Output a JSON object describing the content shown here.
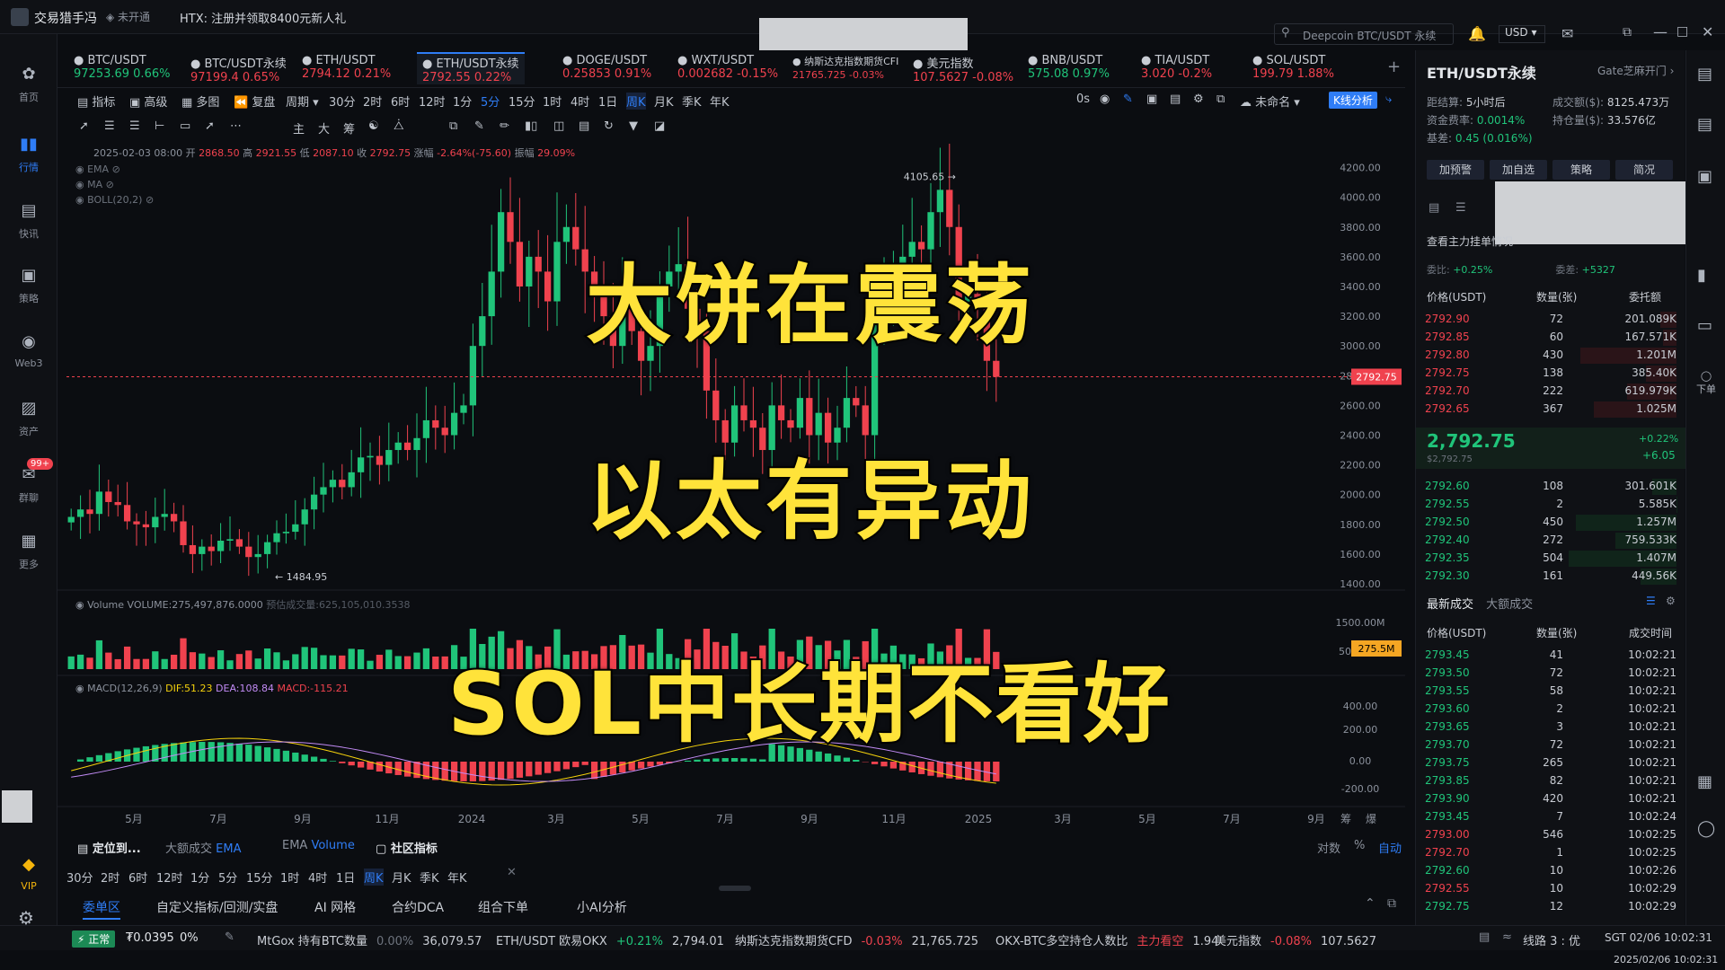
{
  "app": {
    "name": "交易猎手冯",
    "status": "未开通",
    "promo": "HTX:  注册并领取8400元新人礼",
    "search_placeholder": "Deepcoin BTC/USDT 永续",
    "currency": "USD"
  },
  "nav": [
    {
      "label": "首页",
      "icon": "home-icon"
    },
    {
      "label": "行情",
      "icon": "chart-icon"
    },
    {
      "label": "快讯",
      "icon": "news-icon"
    },
    {
      "label": "策略",
      "icon": "robot-icon"
    },
    {
      "label": "Web3",
      "icon": "web3-icon"
    },
    {
      "label": "资产",
      "icon": "wallet-icon"
    },
    {
      "label": "群聊",
      "icon": "chat-icon",
      "badge": "99+"
    },
    {
      "label": "更多",
      "icon": "grid-icon"
    },
    {
      "label": "VIP",
      "icon": "vip-icon"
    }
  ],
  "tickers": [
    {
      "name": "BTC/USDT",
      "price": "97253.69",
      "change": "0.66%",
      "dir": "green"
    },
    {
      "name": "BTC/USDT永续",
      "price": "97199.4",
      "change": "0.65%",
      "dir": "red"
    },
    {
      "name": "ETH/USDT",
      "price": "2794.12",
      "change": "0.21%",
      "dir": "red"
    },
    {
      "name": "ETH/USDT永续",
      "price": "2792.55",
      "change": "0.22%",
      "dir": "red",
      "active": true
    },
    {
      "name": "DOGE/USDT",
      "price": "0.25853",
      "change": "0.91%",
      "dir": "red"
    },
    {
      "name": "WXT/USDT",
      "price": "0.002682",
      "change": "-0.15%",
      "dir": "red"
    },
    {
      "name": "纳斯达克指数期货CFI",
      "price": "21765.725",
      "change": "-0.03%",
      "dir": "red"
    },
    {
      "name": "美元指数",
      "price": "107.5627",
      "change": "-0.08%",
      "dir": "red"
    },
    {
      "name": "BNB/USDT",
      "price": "575.08",
      "change": "0.97%",
      "dir": "green"
    },
    {
      "name": "TIA/USDT",
      "price": "3.020",
      "change": "-0.2%",
      "dir": "red"
    },
    {
      "name": "SOL/USDT",
      "price": "199.79",
      "change": "1.88%",
      "dir": "red"
    }
  ],
  "toolbar": {
    "left": [
      "指标",
      "高级",
      "多图",
      "复盘",
      "周期"
    ],
    "periods": [
      "30分",
      "2时",
      "6时",
      "12时",
      "1分",
      "5分",
      "15分",
      "1时",
      "4时",
      "1日",
      "周K",
      "月K",
      "季K",
      "年K"
    ],
    "active_period": "周K",
    "right": [
      "0s",
      "未命名",
      "K线分析"
    ],
    "draw_tools": [
      "主",
      "大",
      "筹"
    ]
  },
  "ohlc": {
    "date": "2025-02-03 08:00",
    "open_label": "开",
    "open": "2868.50",
    "high_label": "高",
    "high": "2921.55",
    "low_label": "低",
    "low": "2087.10",
    "close_label": "收",
    "close": "2792.75",
    "chg_label": "涨幅",
    "chg": "-2.64%(-75.60)",
    "amp_label": "振幅",
    "amp": "29.09%"
  },
  "indicators": [
    "EMA",
    "MA",
    "BOLL(20,2)"
  ],
  "chart_data": {
    "type": "candlestick",
    "price_axis": [
      "4200.00",
      "4000.00",
      "3800.00",
      "3600.00",
      "3400.00",
      "3200.00",
      "3000.00",
      "2800.00",
      "2600.00",
      "2400.00",
      "2200.00",
      "2000.00",
      "1800.00",
      "1600.00",
      "1400.00"
    ],
    "ylim": [
      1400,
      4300
    ],
    "last_price": "2792.75",
    "high_marker": "4105.65 →",
    "low_marker": "← 1484.95",
    "x_ticks": [
      "5月",
      "7月",
      "9月",
      "11月",
      "2024",
      "3月",
      "5月",
      "7月",
      "9月",
      "11月",
      "2025",
      "3月",
      "5月",
      "7月",
      "9月"
    ],
    "closes": [
      1850,
      1900,
      1870,
      2020,
      1950,
      1930,
      1820,
      1800,
      1780,
      1850,
      1870,
      1820,
      1660,
      1600,
      1650,
      1620,
      1690,
      1700,
      1650,
      1580,
      1600,
      1680,
      1740,
      1750,
      1800,
      1900,
      2000,
      2050,
      2100,
      2050,
      2150,
      2250,
      2260,
      2200,
      2300,
      2350,
      2300,
      2380,
      2500,
      2450,
      2400,
      2550,
      2600,
      3000,
      3200,
      3500,
      3900,
      3700,
      3400,
      3600,
      3500,
      3300,
      3700,
      3800,
      3650,
      3500,
      3400,
      3200,
      3000,
      3300,
      3100,
      2900,
      3000,
      3400,
      3500,
      3550,
      3250,
      3100,
      2700,
      2500,
      2350,
      2600,
      2500,
      2450,
      2300,
      2600,
      2500,
      2450,
      2650,
      2400,
      2550,
      2350,
      2450,
      2650,
      2600,
      2400,
      3200,
      3300,
      3500,
      3600,
      3700,
      3650,
      3900,
      4050,
      3800,
      3300,
      3350,
      3300,
      2900,
      2792
    ],
    "volume_label": "Volume  VOLUME:275,497,876.0000",
    "volume_predict": "预估成交量:625,105,010.3538",
    "volume_axis": [
      "1500.00M",
      "500.00M"
    ],
    "volume_value": "275.5M",
    "macd_label": "MACD(12,26,9)",
    "macd_dif": "DIF:51.23",
    "macd_dea": "DEA:108.84",
    "macd_val": "MACD:-115.21",
    "macd_axis": [
      "400.00",
      "200.00",
      "0.00",
      "-200.00"
    ]
  },
  "chart_footer": {
    "locate": "定位到...",
    "big_trades": "大额成交",
    "ema": "EMA",
    "ema2": "EMA",
    "volume": "Volume",
    "community": "社区指标",
    "periods": [
      "30分",
      "2时",
      "6时",
      "12时",
      "1分",
      "5分",
      "15分",
      "1时",
      "4时",
      "1日",
      "周K",
      "月K",
      "季K",
      "年K"
    ],
    "right": [
      "对数",
      "%",
      "自动"
    ],
    "axis_extra": [
      "筹",
      "爆"
    ]
  },
  "panel_tabs": [
    "委单区",
    "自定义指标/回测/实盘",
    "AI 网格",
    "合约DCA",
    "组合下单",
    "小AI分析"
  ],
  "overlay_text": [
    "大饼在震荡",
    "以太有异动",
    "SOL中长期不看好"
  ],
  "right_panel": {
    "symbol": "ETH/USDT永续",
    "exchange": "Gate芝麻开门",
    "funding_label": "距结算:",
    "funding_time": "5小时后",
    "turnover_label": "成交额($):",
    "turnover": "8125.473万",
    "rate_label": "资金费率:",
    "rate": "0.0014%",
    "oi_label": "持仓量($):",
    "oi": "33.576亿",
    "basis_label": "基差:",
    "basis": "0.45 (0.016%)",
    "buttons": [
      "加预警",
      "加自选",
      "策略",
      "简况"
    ],
    "book_title": "查看主力挂单情况",
    "ratio_label": "委比:",
    "ratio": "+0.25%",
    "diff_label": "委差:",
    "diff": "+5327",
    "book_headers": [
      "价格(USDT)",
      "数量(张)",
      "委托额"
    ],
    "asks": [
      [
        "2792.90",
        "72",
        "201.089K"
      ],
      [
        "2792.85",
        "60",
        "167.571K"
      ],
      [
        "2792.80",
        "430",
        "1.201M"
      ],
      [
        "2792.75",
        "138",
        "385.40K"
      ],
      [
        "2792.70",
        "222",
        "619.979K"
      ],
      [
        "2792.65",
        "367",
        "1.025M"
      ]
    ],
    "mid_price": "2,792.75",
    "mid_sub": "$2,792.75",
    "mid_chg": "+0.22%",
    "mid_abs": "+6.05",
    "bids": [
      [
        "2792.60",
        "108",
        "301.601K"
      ],
      [
        "2792.55",
        "2",
        "5.585K"
      ],
      [
        "2792.50",
        "450",
        "1.257M"
      ],
      [
        "2792.40",
        "272",
        "759.533K"
      ],
      [
        "2792.35",
        "504",
        "1.407M"
      ],
      [
        "2792.30",
        "161",
        "449.56K"
      ]
    ],
    "trades_tabs": [
      "最新成交",
      "大额成交"
    ],
    "trades_headers": [
      "价格(USDT)",
      "数量(张)",
      "成交时间"
    ],
    "trades": [
      [
        "2793.45",
        "41",
        "10:02:21",
        "green"
      ],
      [
        "2793.50",
        "72",
        "10:02:21",
        "green"
      ],
      [
        "2793.55",
        "58",
        "10:02:21",
        "green"
      ],
      [
        "2793.60",
        "2",
        "10:02:21",
        "green"
      ],
      [
        "2793.65",
        "3",
        "10:02:21",
        "green"
      ],
      [
        "2793.70",
        "72",
        "10:02:21",
        "green"
      ],
      [
        "2793.75",
        "265",
        "10:02:21",
        "green"
      ],
      [
        "2793.85",
        "82",
        "10:02:21",
        "green"
      ],
      [
        "2793.90",
        "420",
        "10:02:21",
        "green"
      ],
      [
        "2793.45",
        "7",
        "10:02:24",
        "green"
      ],
      [
        "2793.00",
        "546",
        "10:02:25",
        "red"
      ],
      [
        "2792.70",
        "1",
        "10:02:25",
        "red"
      ],
      [
        "2792.60",
        "10",
        "10:02:26",
        "green"
      ],
      [
        "2792.55",
        "10",
        "10:02:29",
        "red"
      ],
      [
        "2792.75",
        "12",
        "10:02:29",
        "green"
      ]
    ],
    "side_label": "下单"
  },
  "bottom": {
    "status": "正常",
    "fee": "₮0.0395",
    "fee_pct": "0%",
    "items": [
      {
        "name": "MtGox 持有BTC数量",
        "chg": "0.00%",
        "val": "36,079.57",
        "dir": "grey"
      },
      {
        "name": "ETH/USDT 欧易OKX",
        "chg": "+0.21%",
        "val": "2,794.01",
        "dir": "green"
      },
      {
        "name": "纳斯达克指数期货CFD",
        "chg": "-0.03%",
        "val": "21,765.725",
        "dir": "red"
      },
      {
        "name": "OKX-BTC多空持仓人数比",
        "chg": "主力看空",
        "val": "1.94",
        "dir": "red"
      },
      {
        "name": "美元指数",
        "chg": "-0.08%",
        "val": "107.5627",
        "dir": "red"
      }
    ],
    "line": "线路 3 : 优",
    "tz": "SGT 02/06 10:02:31",
    "datetime": "2025/02/06 10:02:31"
  }
}
